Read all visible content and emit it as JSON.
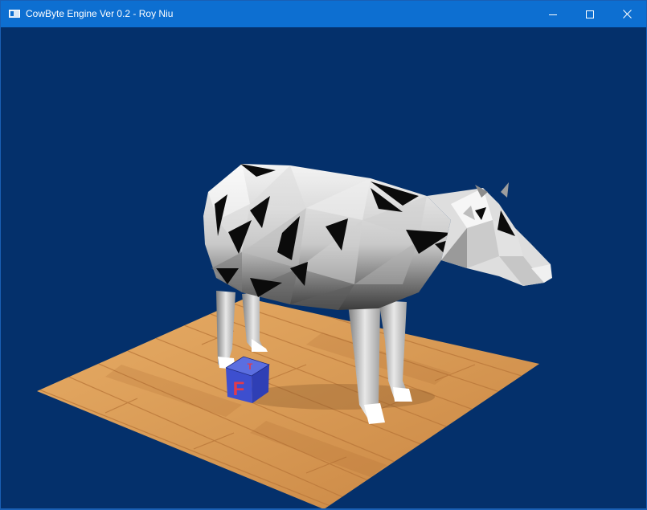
{
  "window": {
    "title": "CowByte Engine Ver 0.2 - Roy Niu",
    "icon": "app-window-icon",
    "controls": {
      "minimize_icon": "minimize-icon",
      "maximize_icon": "maximize-icon",
      "close_icon": "close-icon"
    }
  },
  "scene": {
    "background_color": "#04306b",
    "objects": [
      {
        "name": "cow-model",
        "material": "white-and-black polygonal"
      },
      {
        "name": "wooden-floor-plane",
        "material": "light oak wood planks"
      },
      {
        "name": "letter-cube",
        "material": "blue cube with red letters"
      }
    ],
    "cube_letters": {
      "front": "F",
      "top": "T"
    }
  }
}
